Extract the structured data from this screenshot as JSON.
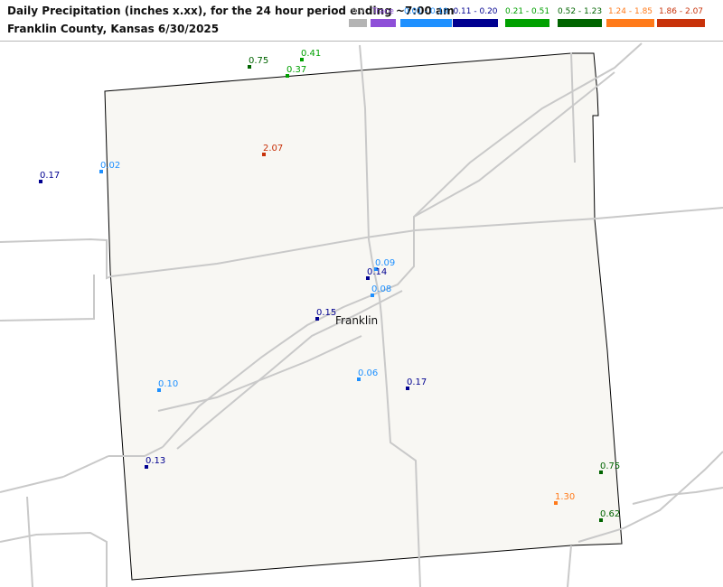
{
  "header": {
    "title_line1": "Daily Precipitation (inches  x.xx),  for the 24 hour period ending ~7:00 am",
    "title_line2": "Franklin County, Kansas  6/30/2025"
  },
  "legend": [
    {
      "label": "0.0",
      "color": "#b4b4b4"
    },
    {
      "label": "Trace",
      "color": "#8e4fd8"
    },
    {
      "label": "0.01 - 0.10",
      "color": "#1e90ff"
    },
    {
      "label": "0.11 - 0.20",
      "color": "#000090"
    },
    {
      "label": "0.21 - 0.51",
      "color": "#00a000"
    },
    {
      "label": "0.52 - 1.23",
      "color": "#006400"
    },
    {
      "label": "1.24 - 1.85",
      "color": "#ff7a1a"
    },
    {
      "label": "1.86 - 2.07",
      "color": "#c8320a"
    }
  ],
  "map": {
    "city": "Franklin",
    "stations": [
      {
        "id": "s1",
        "value": "0.75",
        "class": 5
      },
      {
        "id": "s2",
        "value": "0.41",
        "class": 4
      },
      {
        "id": "s3",
        "value": "0.37",
        "class": 4
      },
      {
        "id": "s4",
        "value": "2.07",
        "class": 7
      },
      {
        "id": "s5",
        "value": "0.17",
        "class": 3
      },
      {
        "id": "s6",
        "value": "0.02",
        "class": 2
      },
      {
        "id": "s7",
        "value": "0.09",
        "class": 2
      },
      {
        "id": "s8",
        "value": "0.14",
        "class": 3
      },
      {
        "id": "s9",
        "value": "0.08",
        "class": 2
      },
      {
        "id": "s10",
        "value": "0.15",
        "class": 3
      },
      {
        "id": "s11",
        "value": "0.10",
        "class": 2
      },
      {
        "id": "s12",
        "value": "0.06",
        "class": 2
      },
      {
        "id": "s13",
        "value": "0.17",
        "class": 3
      },
      {
        "id": "s14",
        "value": "0.13",
        "class": 3
      },
      {
        "id": "s15",
        "value": "0.75",
        "class": 5
      },
      {
        "id": "s16",
        "value": "1.30",
        "class": 6
      },
      {
        "id": "s17",
        "value": "0.62",
        "class": 5
      }
    ]
  }
}
